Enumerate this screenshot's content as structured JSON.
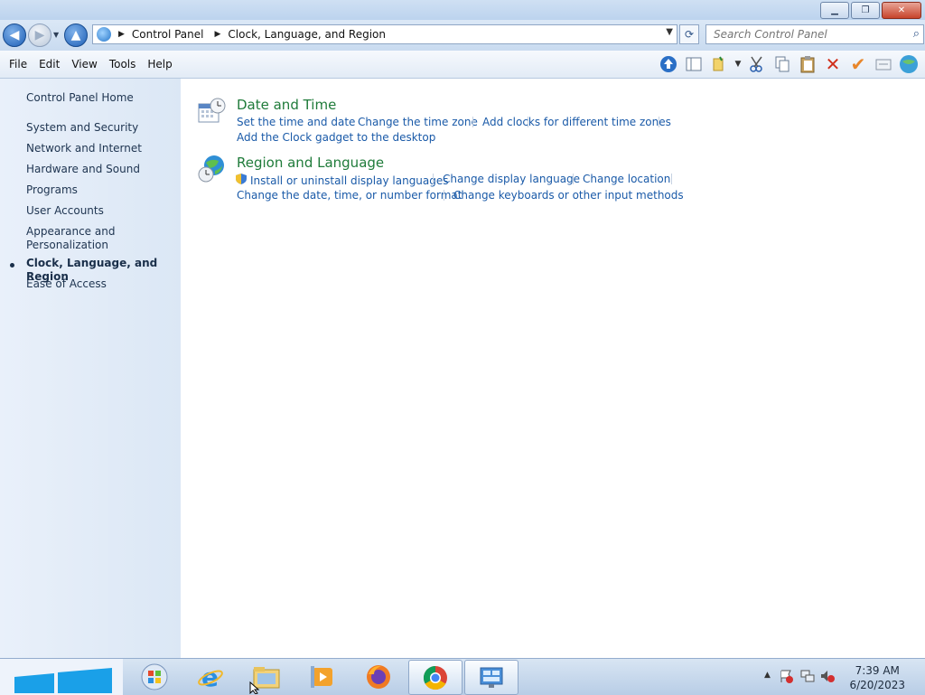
{
  "window": {
    "buttons": {
      "minimize": "▁",
      "maximize": "❐",
      "close": "✕"
    }
  },
  "navigation": {
    "breadcrumbs": [
      "Control Panel",
      "Clock, Language, and Region"
    ],
    "search_placeholder": "Search Control Panel"
  },
  "menu": [
    "File",
    "Edit",
    "View",
    "Tools",
    "Help"
  ],
  "sidebar": {
    "items": [
      {
        "label": "Control Panel Home"
      },
      {
        "label": "System and Security"
      },
      {
        "label": "Network and Internet"
      },
      {
        "label": "Hardware and Sound"
      },
      {
        "label": "Programs"
      },
      {
        "label": "User Accounts"
      },
      {
        "label": "Appearance and Personalization"
      },
      {
        "label": "Clock, Language, and Region",
        "current": true
      },
      {
        "label": "Ease of Access"
      }
    ]
  },
  "categories": [
    {
      "title": "Date and Time",
      "icon": "calendar-clock-icon",
      "tasks": [
        "Set the time and date",
        "Change the time zone",
        "Add clocks for different time zones",
        "Add the Clock gadget to the desktop"
      ]
    },
    {
      "title": "Region and Language",
      "icon": "globe-clock-icon",
      "tasks": [
        "Install or uninstall display languages",
        "Change display language",
        "Change location",
        "Change the date, time, or number format",
        "Change keyboards or other input methods"
      ]
    }
  ],
  "taskbar": {
    "apps": [
      "windows-orb",
      "internet-explorer",
      "file-explorer",
      "media-player",
      "firefox",
      "chrome",
      "control-panel"
    ],
    "clock": {
      "time": "7:39 AM",
      "date": "6/20/2023"
    }
  },
  "colors": {
    "category_title": "#1f7b3a",
    "task_link": "#1a5aa8",
    "sidebar_text": "#1e3450"
  }
}
